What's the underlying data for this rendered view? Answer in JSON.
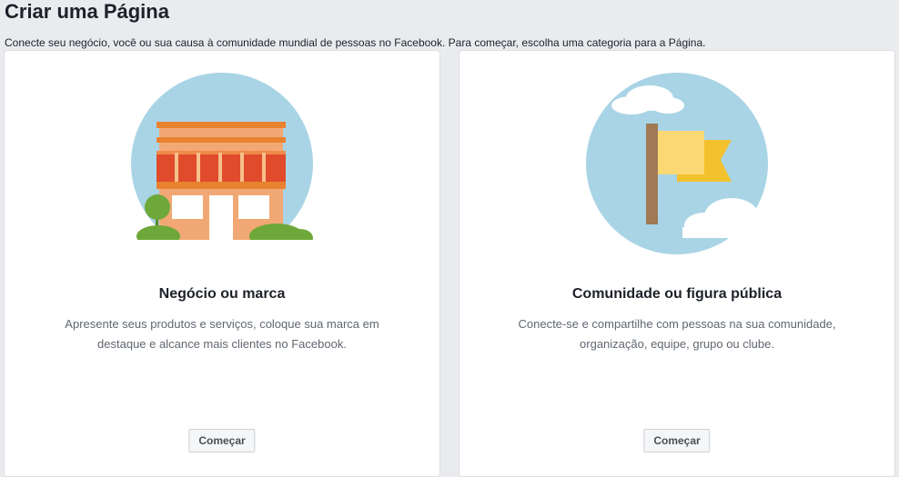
{
  "header": {
    "title": "Criar uma Página",
    "subtitle": "Conecte seu negócio, você ou sua causa à comunidade mundial de pessoas no Facebook. Para começar, escolha uma categoria para a Página."
  },
  "cards": [
    {
      "title": "Negócio ou marca",
      "description": "Apresente seus produtos e serviços, coloque sua marca em destaque e alcance mais clientes no Facebook.",
      "button_label": "Começar",
      "icon": "storefront-icon"
    },
    {
      "title": "Comunidade ou figura pública",
      "description": "Conecte-se e compartilhe com pessoas na sua comunidade, organização, equipe, grupo ou clube.",
      "button_label": "Começar",
      "icon": "flag-icon"
    }
  ],
  "colors": {
    "background": "#e9ebee",
    "card": "#ffffff",
    "circle": "#a9d4e6",
    "awning_red": "#e04b2b",
    "building": "#f2a874",
    "flag_yellow": "#fcd874",
    "pole_brown": "#a07a55"
  }
}
